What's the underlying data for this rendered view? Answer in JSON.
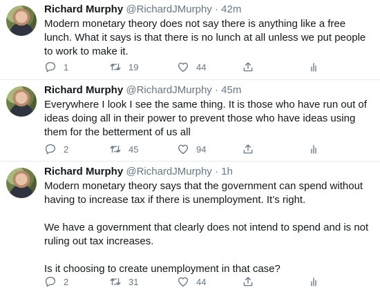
{
  "tweets": [
    {
      "name": "Richard Murphy",
      "handle": "@RichardJMurphy",
      "separator": "·",
      "time": "42m",
      "paragraphs": [
        "Modern monetary theory does not say there is anything like a free lunch. What it says is that there is no lunch at all unless we put people to work to make it."
      ],
      "replies": "1",
      "retweets": "19",
      "likes": "44"
    },
    {
      "name": "Richard Murphy",
      "handle": "@RichardJMurphy",
      "separator": "·",
      "time": "45m",
      "paragraphs": [
        "Everywhere I look I see the same thing. It is those who have run out of ideas doing all in their power to prevent those who have ideas using them for the betterment of us all"
      ],
      "replies": "2",
      "retweets": "45",
      "likes": "94"
    },
    {
      "name": "Richard Murphy",
      "handle": "@RichardJMurphy",
      "separator": "·",
      "time": "1h",
      "paragraphs": [
        "Modern monetary theory says that the government can spend without having to increase tax if there is unemployment. It’s right.",
        "We have a government that clearly does not intend to spend and is not ruling out tax increases.",
        "Is it choosing to create unemployment in that case?"
      ],
      "replies": "2",
      "retweets": "31",
      "likes": "44"
    }
  ],
  "icons": {
    "reply": "reply-icon",
    "retweet": "retweet-icon",
    "like": "heart-icon",
    "share": "share-icon",
    "analytics": "analytics-icon"
  },
  "colors": {
    "text": "#14171a",
    "secondary": "#657786",
    "divider": "#e6ecf0"
  }
}
